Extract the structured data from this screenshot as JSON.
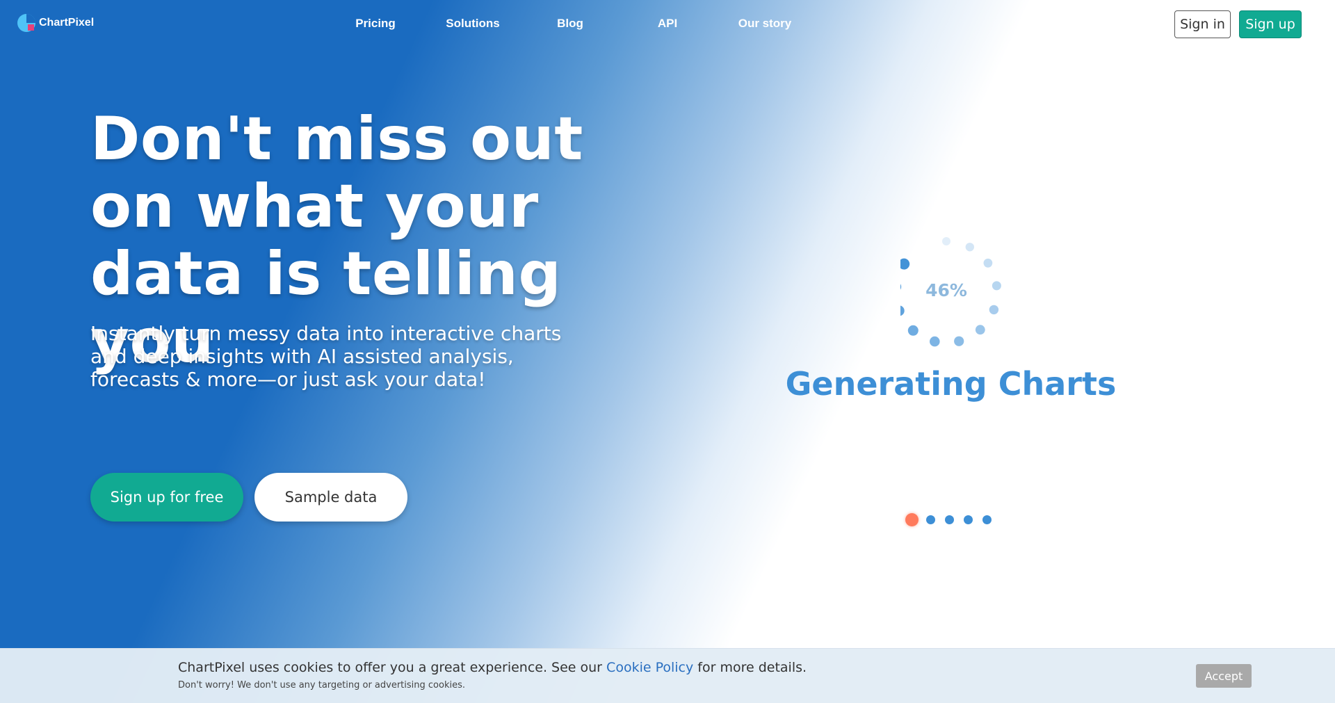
{
  "brand": {
    "name": "ChartPixel",
    "primary_color": "#1a6bc0",
    "accent_color": "#11aa92"
  },
  "nav": {
    "items": [
      {
        "label": "Pricing"
      },
      {
        "label": "Solutions"
      },
      {
        "label": "Blog"
      },
      {
        "label": "API"
      },
      {
        "label": "Our story"
      }
    ]
  },
  "auth": {
    "signin_label": "Sign in",
    "signup_label": "Sign up"
  },
  "hero": {
    "title": "Don't miss out on what your data is telling you",
    "subtitle_lines": [
      "Instantly turn messy data into interactive charts",
      "and deep insights with AI assisted analysis,",
      "forecasts & more—or just ask your data!"
    ],
    "cta_primary": "Sign up for free",
    "cta_secondary": "Sample data"
  },
  "loader": {
    "percent_label": "46%",
    "progress": 0.46,
    "title": "Generating Charts",
    "dot_color": "#3d8fd6",
    "active_dot_color": "#ff7a5c"
  },
  "carousel": {
    "slide_count": 5,
    "active_index": 0
  },
  "cookie": {
    "text_before": "ChartPixel uses cookies to offer you a great experience. See our",
    "link_text": "Cookie Policy",
    "text_after": "for more details.",
    "subtext": "Don't worry! We don't use any targeting or advertising cookies.",
    "accept_label": "Accept"
  }
}
